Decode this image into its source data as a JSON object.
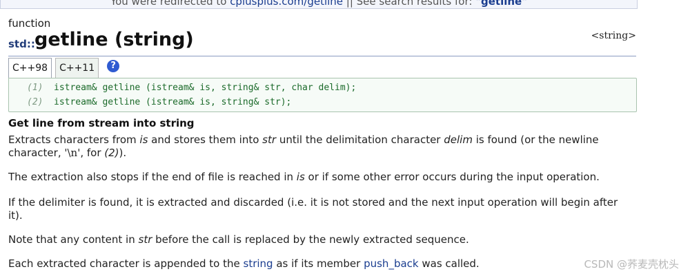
{
  "redirect": {
    "prefix": "You were redirected to ",
    "link": "cplusplus.com/getline",
    "separator": " || See search results for: ",
    "query": "\"getline\""
  },
  "doc": {
    "kind": "function",
    "namespace": "std::",
    "title": "getline (string)",
    "header": "<string>"
  },
  "tabs": [
    {
      "label": "C++98"
    },
    {
      "label": "C++11"
    }
  ],
  "help_icon": "?",
  "prototypes": [
    {
      "num": "(1)",
      "code": "istream& getline (istream& is, string& str, char delim);"
    },
    {
      "num": "(2)",
      "code": "istream& getline (istream& is, string& str);"
    }
  ],
  "section_title": "Get line from stream into string",
  "paragraphs": {
    "p1": {
      "t1": "Extracts characters from ",
      "is": "is",
      "t2": " and stores them into ",
      "str": "str",
      "t3": " until the delimitation character ",
      "delim": "delim",
      "t4": " is found (or the newline character, ",
      "nl": "'\\n'",
      "t5": ", for ",
      "ref": "(2)",
      "t6": ")."
    },
    "p2": {
      "t1": "The extraction also stops if the end of file is reached in ",
      "is": "is",
      "t2": " or if some other error occurs during the input operation."
    },
    "p3": "If the delimiter is found, it is extracted and discarded (i.e. it is not stored and the next input operation will begin after it).",
    "p4": {
      "t1": "Note that any content in ",
      "str": "str",
      "t2": " before the call is replaced by the newly extracted sequence."
    },
    "p5": {
      "t1": "Each extracted character is appended to the ",
      "link1": "string",
      "t2": " as if its member ",
      "link2": "push_back",
      "t3": " was called."
    }
  },
  "watermark": "CSDN @荞麦壳枕头"
}
